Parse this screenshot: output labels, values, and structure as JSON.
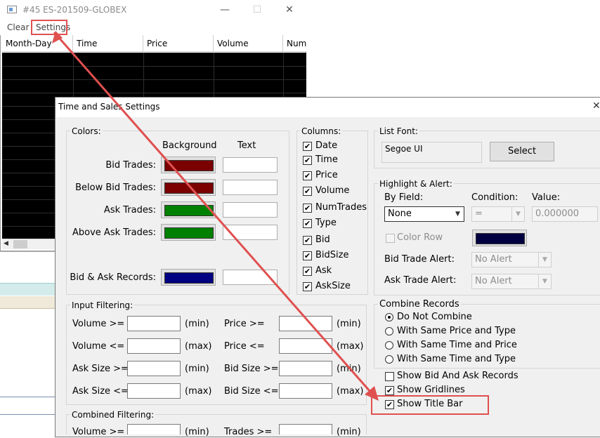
{
  "bg_window": {
    "title": "#45 ES-201509-GLOBEX",
    "menu": [
      "Clear",
      "Settings"
    ],
    "columns": [
      "Month-Day",
      "Time",
      "Price",
      "Volume",
      "Num"
    ]
  },
  "dialog": {
    "title": "Time and Sales Settings",
    "colors": {
      "label": "Colors:",
      "background_header": "Background",
      "text_header": "Text",
      "rows": [
        {
          "label": "Bid Trades:",
          "color": "#7b0000"
        },
        {
          "label": "Below Bid Trades:",
          "color": "#7b0000"
        },
        {
          "label": "Ask Trades:",
          "color": "#008000"
        },
        {
          "label": "Above Ask Trades:",
          "color": "#008000"
        },
        {
          "label": "Bid & Ask Records:",
          "color": "#000080"
        }
      ]
    },
    "columns_group": {
      "label": "Columns:",
      "items": [
        {
          "label": "Date",
          "checked": true
        },
        {
          "label": "Time",
          "checked": true
        },
        {
          "label": "Price",
          "checked": true
        },
        {
          "label": "Volume",
          "checked": true
        },
        {
          "label": "NumTrades",
          "checked": true
        },
        {
          "label": "Type",
          "checked": true
        },
        {
          "label": "Bid",
          "checked": true
        },
        {
          "label": "BidSize",
          "checked": true
        },
        {
          "label": "Ask",
          "checked": true
        },
        {
          "label": "AskSize",
          "checked": true
        }
      ]
    },
    "list_font": {
      "label": "List Font:",
      "font_name": "Segoe UI",
      "select_button": "Select"
    },
    "highlight": {
      "label": "Highlight & Alert:",
      "by_field_label": "By Field:",
      "by_field_value": "None",
      "condition_label": "Condition:",
      "condition_value": "=",
      "value_label": "Value:",
      "value_value": "0.000000",
      "color_row_label": "Color Row",
      "color_row_swatch": "#000040",
      "bid_alert_label": "Bid Trade Alert:",
      "bid_alert_value": "No Alert",
      "ask_alert_label": "Ask Trade Alert:",
      "ask_alert_value": "No Alert"
    },
    "input_filtering": {
      "label": "Input Filtering:",
      "rows": [
        {
          "left_label": "Volume >=",
          "left_unit": "(min)",
          "right_label": "Price >=",
          "right_unit": "(min)"
        },
        {
          "left_label": "Volume <=",
          "left_unit": "(max)",
          "right_label": "Price <=",
          "right_unit": "(max)"
        },
        {
          "left_label": "Ask Size >=",
          "left_unit": "(min)",
          "right_label": "Bid Size >=",
          "right_unit": "(min)"
        },
        {
          "left_label": "Ask Size <=",
          "left_unit": "(max)",
          "right_label": "Bid Size <=",
          "right_unit": "(max)"
        }
      ]
    },
    "combined_filtering": {
      "label": "Combined Filtering:",
      "left_label": "Volume >=",
      "left_unit": "(min)",
      "right_label": "Trades >=",
      "right_unit": "(min)"
    },
    "combine_records": {
      "label": "Combine Records",
      "options": [
        {
          "label": "Do Not Combine",
          "selected": true
        },
        {
          "label": "With Same Price and Type",
          "selected": false
        },
        {
          "label": "With Same Time and Price",
          "selected": false
        },
        {
          "label": "With Same Time and Type",
          "selected": false
        }
      ]
    },
    "options": [
      {
        "label": "Show Bid And Ask Records",
        "checked": false
      },
      {
        "label": "Show Gridlines",
        "checked": true
      },
      {
        "label": "Show Title Bar",
        "checked": true
      }
    ]
  },
  "annotation_color": "#e05050"
}
